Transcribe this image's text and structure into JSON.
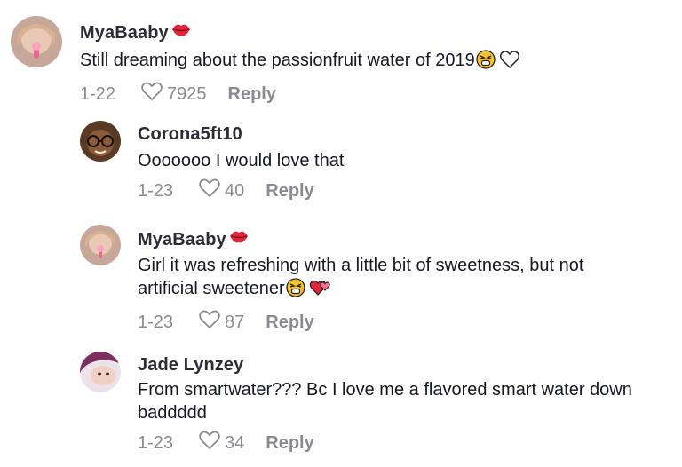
{
  "comments": [
    {
      "username": "MyaBaaby",
      "text_lines": [
        "Still dreaming about the passionfruit water of 2019"
      ],
      "date": "1-22",
      "likes": "7925",
      "reply_label": "Reply",
      "badge_icon": "lips-icon",
      "trailing_icons": [
        "tired-face-icon",
        "white-heart-icon"
      ]
    },
    {
      "username": "Corona5ft10",
      "text_lines": [
        "Ooooooo I would love that"
      ],
      "date": "1-23",
      "likes": "40",
      "reply_label": "Reply"
    },
    {
      "username": "MyaBaaby",
      "text_lines": [
        "Girl it was refreshing with a little bit of sweetness, but not",
        "artificial sweetener"
      ],
      "date": "1-23",
      "likes": "87",
      "reply_label": "Reply",
      "badge_icon": "lips-icon",
      "trailing_icons": [
        "tired-face-icon",
        "two-hearts-icon"
      ]
    },
    {
      "username": "Jade Lynzey",
      "text_lines": [
        "From smartwater??? Bc I love me a flavored smart water down",
        "baddddd"
      ],
      "date": "1-23",
      "likes": "34",
      "reply_label": "Reply"
    }
  ],
  "colors": {
    "text": "#161823",
    "username": "#2b2c34",
    "meta": "#8a8b91",
    "background": "#ffffff"
  }
}
